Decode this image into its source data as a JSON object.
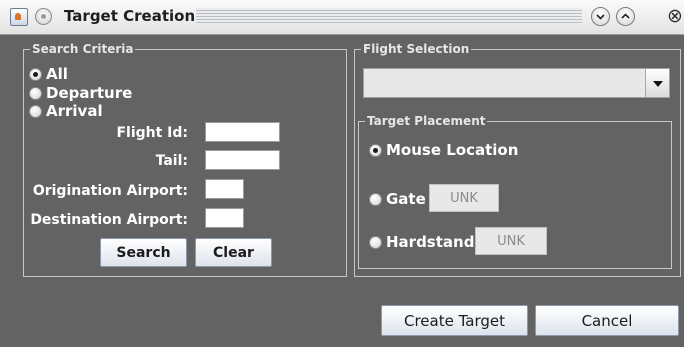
{
  "window": {
    "title": "Target Creation",
    "close_glyph": "⊗"
  },
  "search_criteria": {
    "group_label": "Search Criteria",
    "radios": [
      {
        "label": "All",
        "checked": true
      },
      {
        "label": "Departure",
        "checked": false
      },
      {
        "label": "Arrival",
        "checked": false
      }
    ],
    "fields": {
      "flight_id": {
        "label": "Flight Id:",
        "value": ""
      },
      "tail": {
        "label": "Tail:",
        "value": ""
      },
      "origination": {
        "label": "Origination Airport:",
        "value": ""
      },
      "destination": {
        "label": "Destination Airport:",
        "value": ""
      }
    },
    "search_button": "Search",
    "clear_button": "Clear"
  },
  "flight_selection": {
    "group_label": "Flight Selection",
    "selected_value": ""
  },
  "target_placement": {
    "group_label": "Target Placement",
    "mouse_location": {
      "label": "Mouse Location",
      "checked": true
    },
    "gate": {
      "label": "Gate",
      "checked": false,
      "value": "UNK"
    },
    "hardstand": {
      "label": "Hardstand",
      "checked": false,
      "value": "UNK"
    }
  },
  "footer": {
    "create_button": "Create Target",
    "cancel_button": "Cancel"
  },
  "icons": {
    "app": "app-icon",
    "window_menu": "window-menu-icon",
    "minimize": "minimize-icon",
    "maximize": "maximize-icon",
    "close": "close-icon",
    "dropdown": "chevron-down-icon"
  }
}
